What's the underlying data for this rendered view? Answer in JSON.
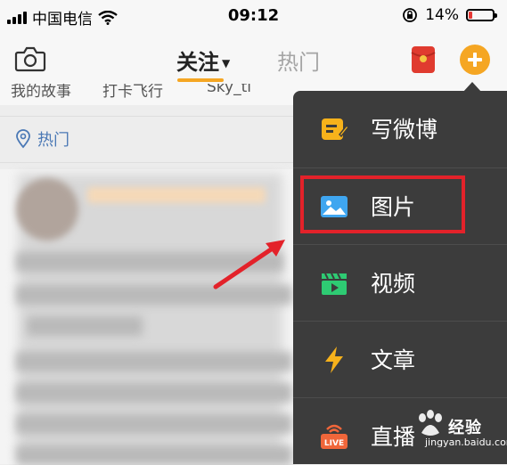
{
  "status_bar": {
    "carrier": "中国电信",
    "time": "09:12",
    "battery_text": "14%",
    "battery_level": 0.14
  },
  "nav": {
    "tab_follow": "关注",
    "tab_hot": "热门"
  },
  "groups": [
    "我的故事",
    "打卡飞行",
    "Sky_ti"
  ],
  "hot_label": "热门",
  "menu": {
    "items": [
      {
        "label": "写微博",
        "icon": "compose-icon"
      },
      {
        "label": "图片",
        "icon": "image-icon"
      },
      {
        "label": "视频",
        "icon": "video-icon"
      },
      {
        "label": "文章",
        "icon": "lightning-icon"
      },
      {
        "label": "直播",
        "icon": "live-icon"
      }
    ]
  },
  "watermark": {
    "brand": "经验",
    "site": "jingyan.baidu.com"
  },
  "colors": {
    "accent": "#f5a623",
    "menu_bg": "#3c3c3c",
    "highlight": "#e3222a",
    "link_blue": "#4a78b5"
  }
}
